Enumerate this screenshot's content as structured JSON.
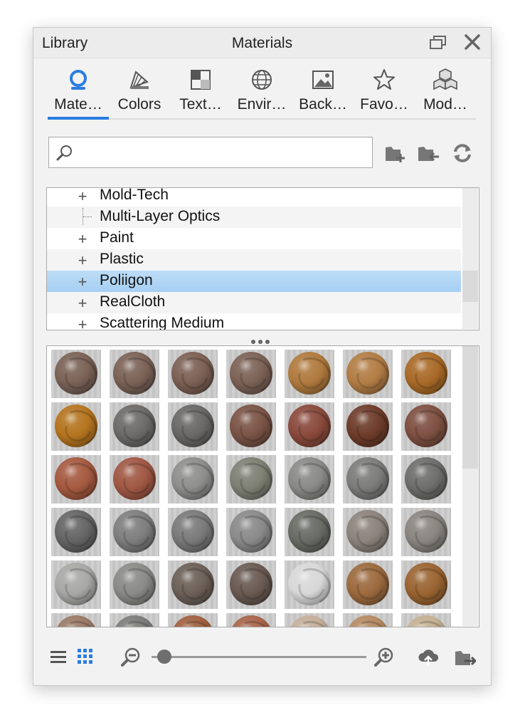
{
  "window": {
    "left_title": "Library",
    "center_title": "Materials"
  },
  "tabs": [
    {
      "label": "Mate…",
      "icon": "materials-icon",
      "active": true
    },
    {
      "label": "Colors",
      "icon": "colors-icon"
    },
    {
      "label": "Text…",
      "icon": "textures-icon"
    },
    {
      "label": "Envir…",
      "icon": "environments-icon"
    },
    {
      "label": "Back…",
      "icon": "backplates-icon"
    },
    {
      "label": "Favo…",
      "icon": "favorites-icon"
    },
    {
      "label": "Mod…",
      "icon": "models-icon"
    }
  ],
  "search": {
    "value": "",
    "placeholder": ""
  },
  "tree": {
    "items": [
      {
        "label": "Mold-Tech",
        "type": "folder"
      },
      {
        "label": "Multi-Layer Optics",
        "type": "leaf"
      },
      {
        "label": "Paint",
        "type": "folder"
      },
      {
        "label": "Plastic",
        "type": "folder"
      },
      {
        "label": "Poliigon",
        "type": "folder",
        "selected": true
      },
      {
        "label": "RealCloth",
        "type": "folder"
      },
      {
        "label": "Scattering Medium",
        "type": "folder"
      }
    ]
  },
  "materials": [
    "#7a6256",
    "#7b6257",
    "#7c6054",
    "#7c6256",
    "#b07a3e",
    "#b27d45",
    "#a96a28",
    "#b57520",
    "#6d6b69",
    "#6a6866",
    "#7a5446",
    "#8a4a3c",
    "#6e3c2a",
    "#7e5042",
    "#a55a40",
    "#a05844",
    "#8e8e8c",
    "#7e8074",
    "#8a8a88",
    "#7c7c7a",
    "#6e6e6c",
    "#656565",
    "#7e7e7e",
    "#7a7a7a",
    "#8a8a8a",
    "#686c64",
    "#8c837c",
    "#8a8580",
    "#a8a8a6",
    "#8a8a88",
    "#6c6058",
    "#6a5a52",
    "#d8d8d8",
    "#9c6a3e",
    "#9a6432",
    "#9a7a66",
    "#7c7c7a",
    "#a06040",
    "#a8644a",
    "#c4ae9a",
    "#b48a62",
    "#c4b092"
  ],
  "colors": {
    "accent": "#2a7de1",
    "selection": "#a7cff2"
  }
}
